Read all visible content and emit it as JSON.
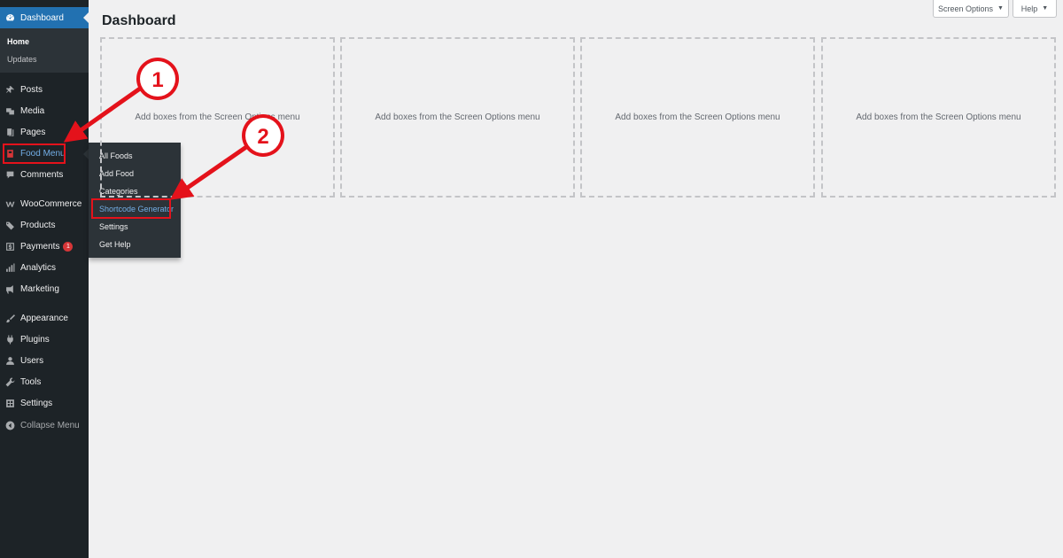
{
  "sidebar": {
    "dashboard": "Dashboard",
    "home": "Home",
    "updates": "Updates",
    "posts": "Posts",
    "media": "Media",
    "pages": "Pages",
    "food_menu": "Food Menu",
    "comments": "Comments",
    "woocommerce": "WooCommerce",
    "products": "Products",
    "payments": "Payments",
    "payments_badge": "1",
    "analytics": "Analytics",
    "marketing": "Marketing",
    "appearance": "Appearance",
    "plugins": "Plugins",
    "users": "Users",
    "tools": "Tools",
    "settings": "Settings",
    "collapse": "Collapse Menu"
  },
  "flyout": {
    "items": [
      "All Foods",
      "Add Food",
      "Categories",
      "Shortcode Generator",
      "Settings",
      "Get Help"
    ]
  },
  "header": {
    "title": "Dashboard",
    "screen_options": "Screen Options",
    "help": "Help"
  },
  "boxes": {
    "placeholder": "Add boxes from the Screen Options menu"
  },
  "annotations": {
    "step1": "1",
    "step2": "2"
  },
  "colors": {
    "sidebar_bg": "#1d2327",
    "accent": "#2271b1",
    "highlight": "#e4121b"
  }
}
